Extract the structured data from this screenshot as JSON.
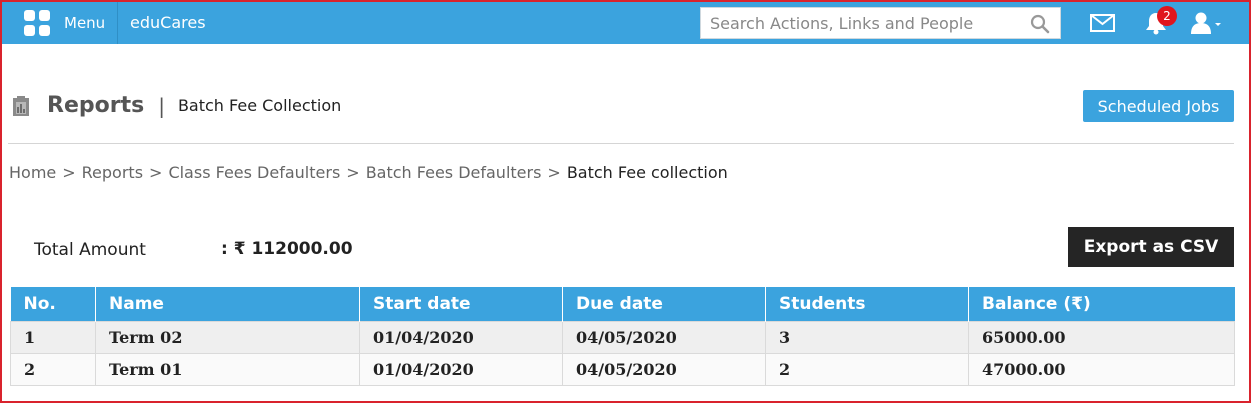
{
  "topbar": {
    "menu_label": "Menu",
    "brand": "eduCares",
    "search_placeholder": "Search Actions, Links and People",
    "notification_count": "2"
  },
  "header": {
    "title": "Reports",
    "separator": "|",
    "subtitle": "Batch Fee Collection",
    "scheduled_jobs_label": "Scheduled Jobs"
  },
  "breadcrumb": {
    "separator": ">",
    "items": [
      "Home",
      "Reports",
      "Class Fees Defaulters",
      "Batch Fees Defaulters"
    ],
    "current": "Batch Fee collection"
  },
  "summary": {
    "total_label": "Total Amount",
    "total_value": ": ₹ 112000.00"
  },
  "export_label": "Export as CSV",
  "table": {
    "headers": [
      "No.",
      "Name",
      "Start date",
      "Due date",
      "Students",
      "Balance (₹)"
    ],
    "rows": [
      [
        "1",
        "Term 02",
        "01/04/2020",
        "04/05/2020",
        "3",
        "65000.00"
      ],
      [
        "2",
        "Term 01",
        "01/04/2020",
        "04/05/2020",
        "2",
        "47000.00"
      ]
    ]
  },
  "colors": {
    "accent": "#3ba3de",
    "frame": "#d9232d",
    "badge": "#e0161e",
    "export_button": "#252525"
  }
}
